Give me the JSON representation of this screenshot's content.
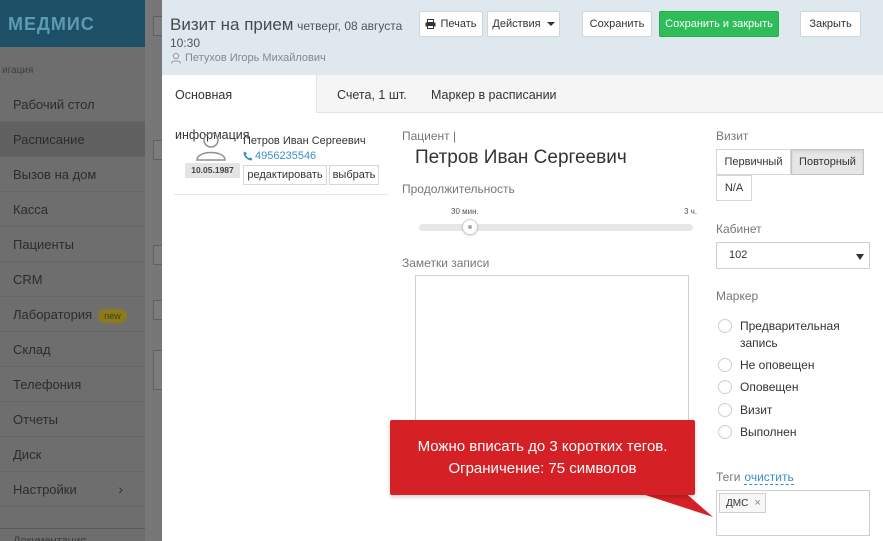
{
  "app": {
    "brand": "МЕДМИС",
    "section_label": "игация"
  },
  "sidebar": {
    "items": [
      {
        "label": "Рабочий стол"
      },
      {
        "label": "Расписание"
      },
      {
        "label": "Вызов на дом"
      },
      {
        "label": "Касса"
      },
      {
        "label": "Пациенты"
      },
      {
        "label": "CRM"
      },
      {
        "label": "Лаборатория",
        "badge": "new"
      },
      {
        "label": "Склад"
      },
      {
        "label": "Телефония"
      },
      {
        "label": "Отчеты"
      },
      {
        "label": "Диск"
      },
      {
        "label": "Настройки",
        "chevron": "›"
      }
    ],
    "bottom_label": "Документация"
  },
  "modal": {
    "title": "Визит на прием",
    "date": "четверг, 08 августа",
    "time": "10:30",
    "doctor": "Петухов Игорь Михайлович",
    "buttons": {
      "print": "Печать",
      "actions": "Действия",
      "save": "Сохранить",
      "save_close": "Сохранить и закрыть",
      "close": "Закрыть"
    },
    "tabs": [
      "Основная информация",
      "Счета, 1 шт.",
      "Маркер в расписании"
    ]
  },
  "patient_card": {
    "name": "Петров Иван Сергеевич",
    "phone": "4956235546",
    "dob": "10.05.1987",
    "edit_label": "редактировать",
    "select_label": "выбрать"
  },
  "main": {
    "patient_label": "Пациент |",
    "patient_name": "Петров Иван Сергеевич",
    "duration_label": "Продолжительность",
    "duration_min_label": "30 мин.",
    "duration_max_label": "3 ч.",
    "duration_fraction": 0.17,
    "notes_label": "Заметки записи",
    "notes_value": ""
  },
  "visit": {
    "label": "Визит",
    "options": [
      "Первичный",
      "Повторный",
      "N/A"
    ],
    "selected": "Повторный"
  },
  "cabinet": {
    "label": "Кабинет",
    "value": "102"
  },
  "marker": {
    "label": "Маркер",
    "options": [
      "Предварительная запись",
      "Не оповещен",
      "Оповещен",
      "Визит",
      "Выполнен"
    ]
  },
  "tags": {
    "label": "Теги",
    "clear": "очистить",
    "items": [
      {
        "text": "ДМС",
        "remove": "×"
      }
    ]
  },
  "callout": {
    "line1": "Можно вписать до 3 коротких тегов.",
    "line2": "Ограничение: 75 символов"
  },
  "colors": {
    "accent_green": "#2ebd59",
    "callout_red": "#d52026",
    "link_blue": "#3a8fc5",
    "header_bg": "#dfe8ee"
  },
  "icons": {
    "print": "printer-icon",
    "user": "user-icon",
    "phone": "phone-icon",
    "avatar": "avatar-icon"
  }
}
